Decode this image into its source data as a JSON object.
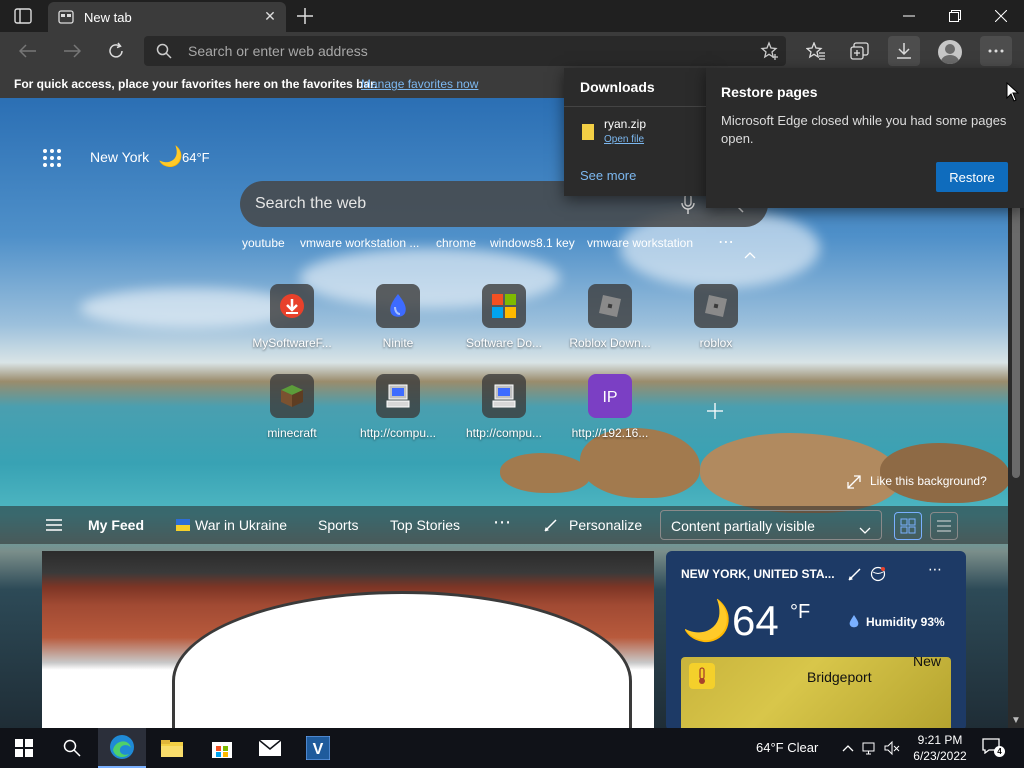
{
  "browser": {
    "tab": {
      "title": "New tab"
    },
    "omnibox": {
      "placeholder": "Search or enter web address"
    },
    "favorites_bar": {
      "text": "For quick access, place your favorites here on the favorites bar.",
      "link": "Manage favorites now"
    }
  },
  "newtab": {
    "weather": {
      "location": "New York",
      "temp": "64°F",
      "icon": "moon-icon"
    },
    "search": {
      "placeholder": "Search the web"
    },
    "quick_links": [
      "youtube",
      "vmware workstation ...",
      "chrome",
      "windows8.1 key",
      "vmware workstation"
    ],
    "tiles": [
      {
        "label": "MySoftwareF...",
        "icon": "download-circle-icon",
        "color": "#e8412b"
      },
      {
        "label": "Ninite",
        "icon": "ninite-icon",
        "color": "#3d6bff"
      },
      {
        "label": "Software Do...",
        "icon": "microsoft-logo-icon",
        "color": "#f25022"
      },
      {
        "label": "Roblox Down...",
        "icon": "roblox-icon",
        "color": "#8a8a8a"
      },
      {
        "label": "roblox",
        "icon": "roblox-icon",
        "color": "#8a8a8a"
      },
      {
        "label": "minecraft",
        "icon": "minecraft-block-icon",
        "color": "#5c9c3a"
      },
      {
        "label": "http://compu...",
        "icon": "computer-icon",
        "color": "#c0c0c0"
      },
      {
        "label": "http://compu...",
        "icon": "computer-icon",
        "color": "#c0c0c0"
      },
      {
        "label": "http://192.16...",
        "icon": "ip-icon",
        "color": "#7b3fc4"
      }
    ],
    "like_background": "Like this background?",
    "feed": {
      "items": [
        "My Feed",
        "War in Ukraine",
        "Sports",
        "Top Stories"
      ],
      "personalize": "Personalize",
      "visibility": "Content partially visible"
    },
    "weather_card": {
      "location": "NEW YORK, UNITED STA...",
      "temp": "64",
      "unit": "°F",
      "humidity": "Humidity 93%",
      "map_city": "Bridgeport",
      "map_label": "New"
    }
  },
  "downloads": {
    "title": "Downloads",
    "file_name": "ryan.zip",
    "open_file": "Open file",
    "see_more": "See more"
  },
  "restore": {
    "title": "Restore pages",
    "body": "Microsoft Edge closed while you had some pages open.",
    "button": "Restore"
  },
  "taskbar": {
    "weather": "64°F  Clear",
    "time": "9:21 PM",
    "date": "6/23/2022",
    "notifications": "4"
  }
}
